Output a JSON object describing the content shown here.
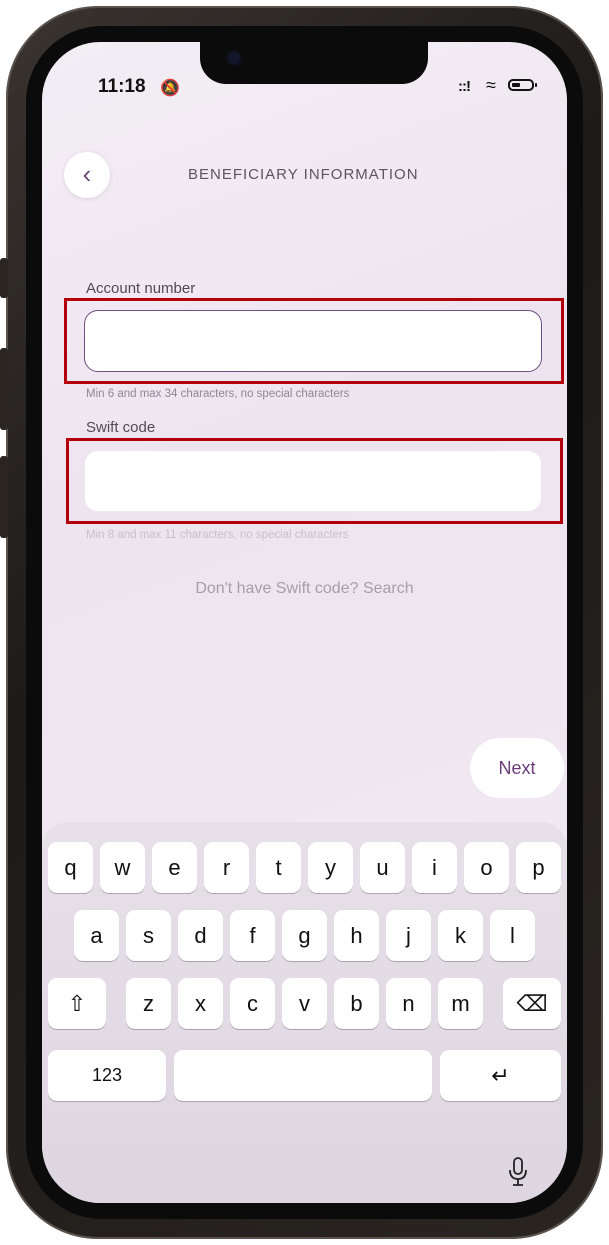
{
  "status_bar": {
    "time": "11:18"
  },
  "header": {
    "title": "BENEFICIARY INFORMATION"
  },
  "form": {
    "account_number": {
      "label": "Account number",
      "value": "",
      "hint": "Min 6 and max 34 characters, no special characters"
    },
    "swift_code": {
      "label": "Swift code",
      "value": "",
      "hint": "Min 8 and max 11 characters, no special characters"
    }
  },
  "swift_search_text": "Don't have Swift code? Search",
  "next_button": "Next",
  "keyboard": {
    "row1": [
      "q",
      "w",
      "e",
      "r",
      "t",
      "y",
      "u",
      "i",
      "o",
      "p"
    ],
    "row2": [
      "a",
      "s",
      "d",
      "f",
      "g",
      "h",
      "j",
      "k",
      "l"
    ],
    "row3": [
      "z",
      "x",
      "c",
      "v",
      "b",
      "n",
      "m"
    ],
    "numbers_key": "123"
  },
  "colors": {
    "accent": "#6a3d7a",
    "highlight": "#b3000b"
  }
}
